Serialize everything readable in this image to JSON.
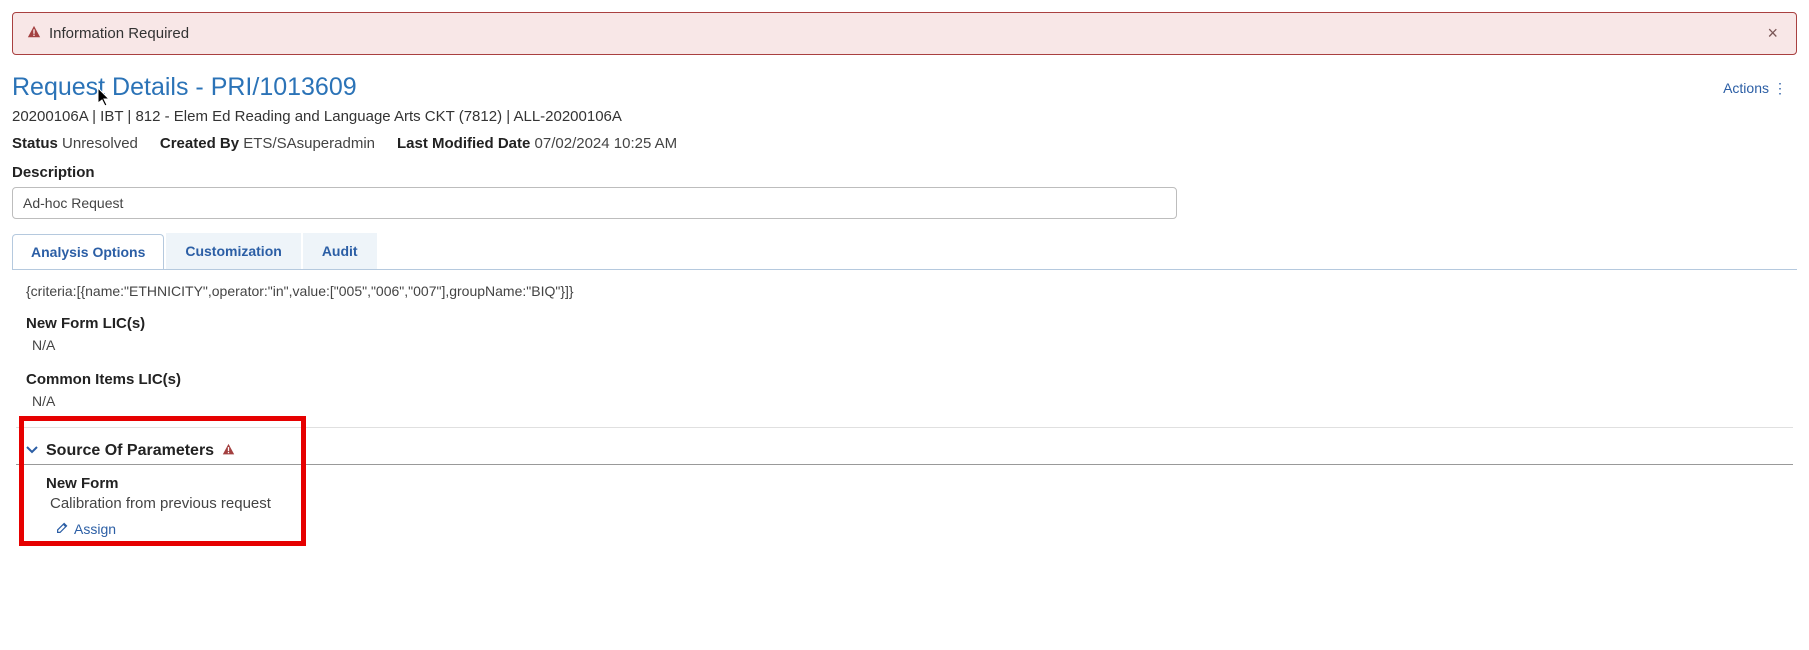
{
  "alert": {
    "icon_name": "warning-icon",
    "text": "Information Required",
    "close_glyph": "×"
  },
  "header": {
    "title": "Request Details - PRI/1013609",
    "actions_label": "Actions"
  },
  "breadcrumb": "20200106A | IBT | 812 - Elem Ed Reading and Language Arts CKT (7812) | ALL-20200106A",
  "meta": {
    "status_label": "Status",
    "status_value": "Unresolved",
    "created_by_label": "Created By",
    "created_by_value": "ETS/SAsuperadmin",
    "modified_label": "Last Modified Date",
    "modified_value": "07/02/2024 10:25 AM"
  },
  "description": {
    "label": "Description",
    "value": "Ad-hoc Request"
  },
  "tabs": [
    {
      "id": "analysis",
      "label": "Analysis Options",
      "active": true
    },
    {
      "id": "customization",
      "label": "Customization",
      "active": false
    },
    {
      "id": "audit",
      "label": "Audit",
      "active": false
    }
  ],
  "panel": {
    "criteria_line": "{criteria:[{name:\"ETHNICITY\",operator:\"in\",value:[\"005\",\"006\",\"007\"],groupName:\"BIQ\"}]}",
    "new_form_lic_label": "New Form LIC(s)",
    "new_form_lic_value": "N/A",
    "common_items_lic_label": "Common Items LIC(s)",
    "common_items_lic_value": "N/A",
    "source_section_label": "Source Of Parameters",
    "new_form_label": "New Form",
    "new_form_value": "Calibration from previous request",
    "assign_label": "Assign"
  }
}
